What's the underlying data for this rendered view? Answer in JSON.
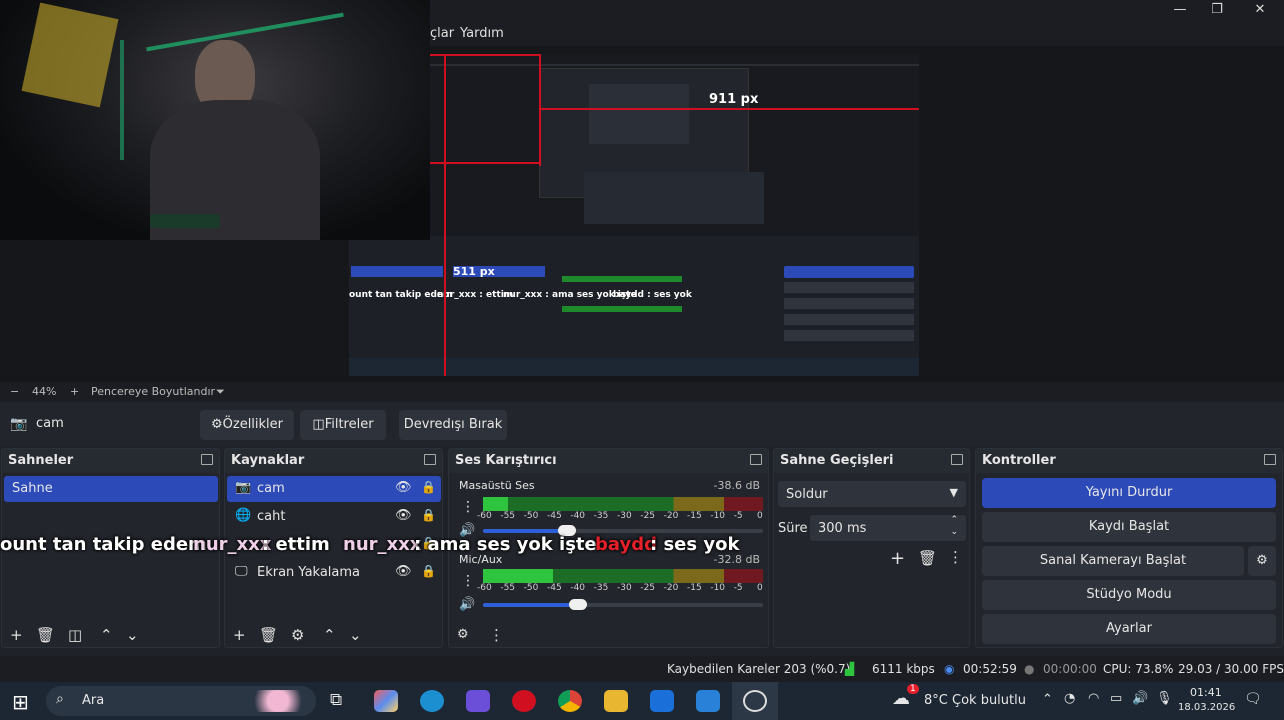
{
  "window": {
    "minimize": "—",
    "restore": "❐",
    "close": "✕"
  },
  "menu": {
    "items": [
      "çlar",
      "Yardım"
    ]
  },
  "preview": {
    "nested_label_911": "911 px",
    "nested_label_511": "511 px",
    "nested_overlay": [
      "ount tan takip edem",
      "nur_xxx : ettim",
      "nur_xxx : ama ses yok işte",
      "baydd : ses yok"
    ]
  },
  "zoom": {
    "minus": "−",
    "value": "44%",
    "plus": "+",
    "fit_label": "Pencereye Boyutlandır",
    "dropdown": "⏷"
  },
  "source_bar": {
    "source_name": "cam",
    "properties_label": "Özellikler",
    "filters_label": "Filtreler",
    "deactivate_label": "Devredışı Bırak"
  },
  "scenes": {
    "title": "Sahneler",
    "items": [
      "Sahne"
    ]
  },
  "sources": {
    "title": "Kaynaklar",
    "items": [
      {
        "name": "cam",
        "icon": "camera-icon"
      },
      {
        "name": "caht",
        "icon": "browser-icon"
      },
      {
        "name": "",
        "icon": "image-icon"
      },
      {
        "name": "Ekran Yakalama",
        "icon": "monitor-icon"
      }
    ]
  },
  "mixer": {
    "title": "Ses Karıştırıcı",
    "channels": [
      {
        "name": "Masaüstü Ses",
        "db": "-38.6 dB",
        "level": 0.09,
        "volume": 0.3
      },
      {
        "name": "Mic/Aux",
        "db": "-32.8 dB",
        "level": 0.25,
        "volume": 0.34
      }
    ],
    "scale": [
      "-60",
      "-55",
      "-50",
      "-45",
      "-40",
      "-35",
      "-30",
      "-25",
      "-20",
      "-15",
      "-10",
      "-5",
      "0"
    ]
  },
  "transitions": {
    "title": "Sahne Geçişleri",
    "selected": "Soldur",
    "duration_label": "Süre",
    "duration_value": "300 ms"
  },
  "controls": {
    "title": "Kontroller",
    "stop_stream": "Yayını Durdur",
    "start_record": "Kaydı Başlat",
    "virtual_cam": "Sanal Kamerayı Başlat",
    "studio_mode": "Stüdyo Modu",
    "settings": "Ayarlar"
  },
  "chat_overlay": {
    "line1": "ount tan takip edem",
    "user1": "nur_xxx",
    "msg1": " : ettim",
    "user2": "nur_xxx",
    "msg2": " : ama ses yok işte",
    "user3": "baydd",
    "msg3": " : ses yok"
  },
  "status": {
    "dropped": "Kaybedilen Kareler 203 (%0.7)",
    "bitrate": "6111 kbps",
    "stream_time": "00:52:59",
    "record_time": "00:00:00",
    "cpu": "CPU: 73.8%",
    "fps": "29.03 / 30.00 FPS"
  },
  "taskbar": {
    "search": "Ara",
    "weather": "8°C",
    "weather_desc": "Çok bulutlu",
    "weather_badge": "1",
    "time": "01:41",
    "date": "18.03.2026"
  },
  "colors": {
    "accent": "#2c4ab8",
    "meter_green": "#1f8a2c",
    "meter_yellow": "#8a7a1f",
    "meter_red": "#8a1f24",
    "nick_red": "#e5202a"
  }
}
